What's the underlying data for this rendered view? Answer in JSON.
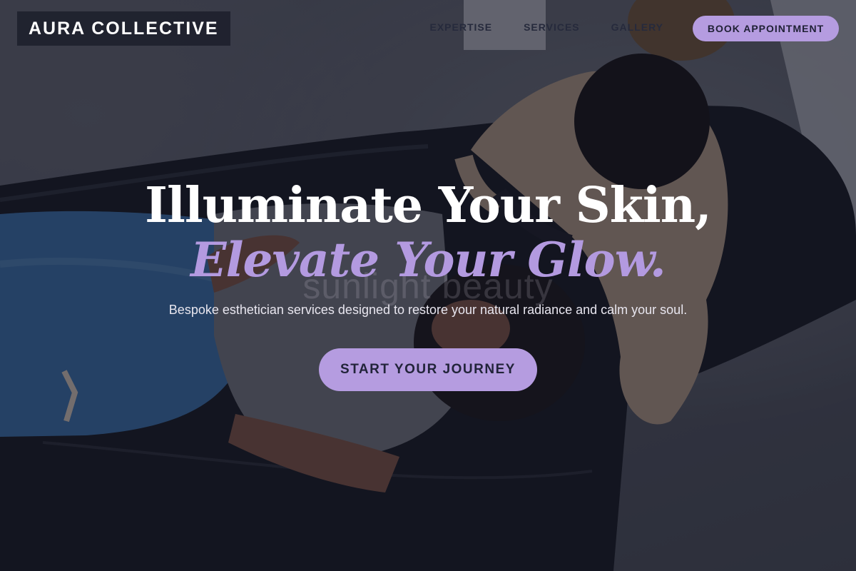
{
  "brand": {
    "name": "AURA COLLECTIVE"
  },
  "nav": {
    "items": [
      {
        "label": "EXPERTISE"
      },
      {
        "label": "SERVICES"
      },
      {
        "label": "GALLERY"
      }
    ],
    "book_label": "BOOK APPOINTMENT"
  },
  "hero": {
    "headline_line1": "Illuminate Your Skin,",
    "headline_line2": "Elevate Your Glow.",
    "subheadline": "Bespoke esthetician services designed to restore your natural radiance and calm your soul.",
    "cta_label": "START YOUR JOURNEY",
    "watermark": "sunlight beauty"
  },
  "colors": {
    "accent": "#b59ce0",
    "accent_text": "#b39ae0",
    "overlay": "#121422",
    "logo_bg": "#1c1e2c"
  }
}
